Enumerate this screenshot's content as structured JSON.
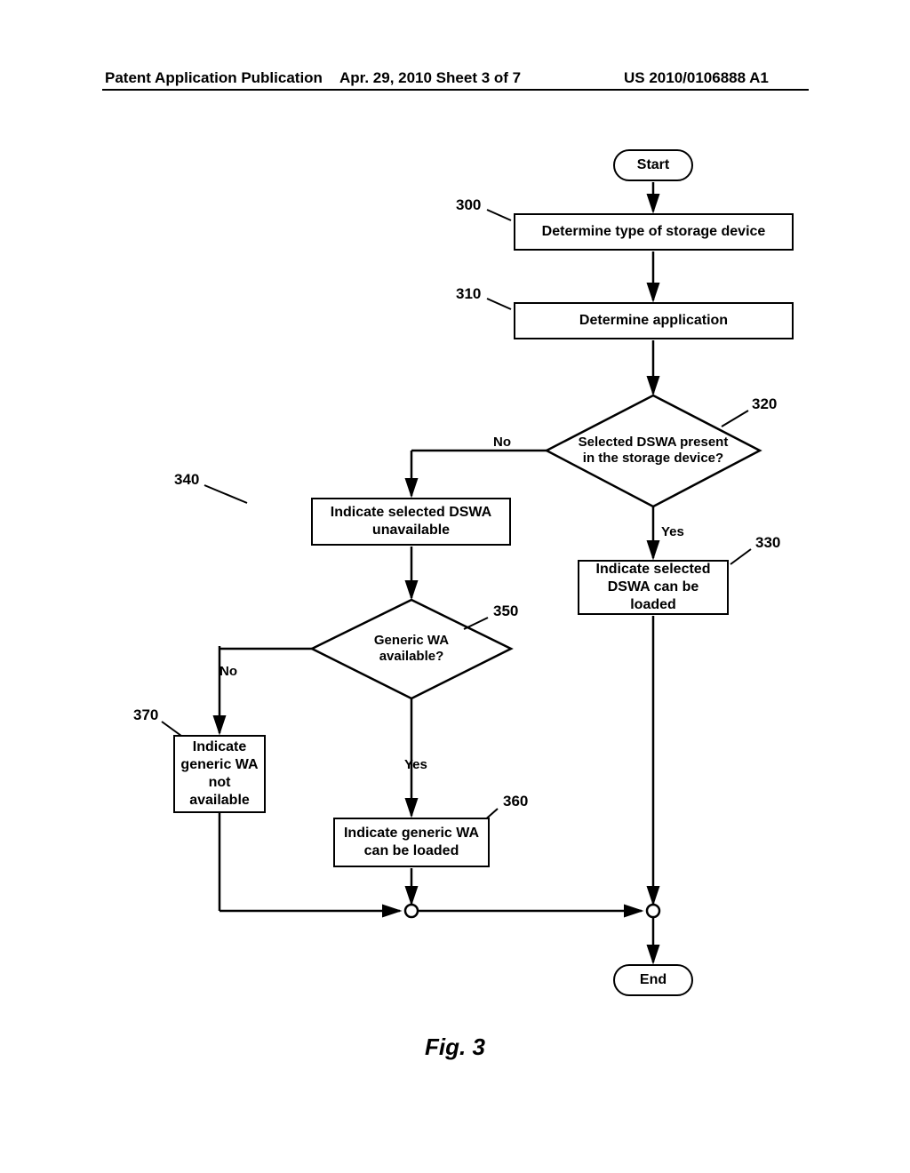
{
  "header": {
    "left": "Patent Application Publication",
    "center": "Apr. 29, 2010  Sheet 3 of 7",
    "right": "US 2010/0106888 A1"
  },
  "labels": {
    "n300": "300",
    "n310": "310",
    "n320": "320",
    "n330": "330",
    "n340": "340",
    "n350": "350",
    "n360": "360",
    "n370": "370"
  },
  "nodes": {
    "start": "Start",
    "b300": "Determine type of storage device",
    "b310": "Determine application",
    "d320": "Selected DSWA present in the storage device?",
    "b330": "Indicate selected DSWA can be loaded",
    "b340": "Indicate selected DSWA unavailable",
    "d350": "Generic WA available?",
    "b360": "Indicate generic WA can be loaded",
    "b370": "Indicate generic WA not available",
    "end": "End"
  },
  "edges": {
    "yes": "Yes",
    "no": "No"
  },
  "figcap": "Fig. 3",
  "chart_data": {
    "type": "flowchart",
    "nodes": [
      {
        "id": "start",
        "type": "terminal",
        "label": "Start"
      },
      {
        "id": "300",
        "type": "process",
        "label": "Determine type of storage device"
      },
      {
        "id": "310",
        "type": "process",
        "label": "Determine application"
      },
      {
        "id": "320",
        "type": "decision",
        "label": "Selected DSWA present in the storage device?"
      },
      {
        "id": "330",
        "type": "process",
        "label": "Indicate selected DSWA can be loaded"
      },
      {
        "id": "340",
        "type": "process",
        "label": "Indicate selected DSWA unavailable"
      },
      {
        "id": "350",
        "type": "decision",
        "label": "Generic WA available?"
      },
      {
        "id": "360",
        "type": "process",
        "label": "Indicate generic WA can be loaded"
      },
      {
        "id": "370",
        "type": "process",
        "label": "Indicate generic WA not available"
      },
      {
        "id": "join1",
        "type": "connector"
      },
      {
        "id": "join2",
        "type": "connector"
      },
      {
        "id": "end",
        "type": "terminal",
        "label": "End"
      }
    ],
    "edges": [
      {
        "from": "start",
        "to": "300"
      },
      {
        "from": "300",
        "to": "310"
      },
      {
        "from": "310",
        "to": "320"
      },
      {
        "from": "320",
        "to": "330",
        "label": "Yes"
      },
      {
        "from": "320",
        "to": "340",
        "label": "No"
      },
      {
        "from": "340",
        "to": "350"
      },
      {
        "from": "350",
        "to": "360",
        "label": "Yes"
      },
      {
        "from": "350",
        "to": "370",
        "label": "No"
      },
      {
        "from": "360",
        "to": "join1"
      },
      {
        "from": "370",
        "to": "join1"
      },
      {
        "from": "join1",
        "to": "join2"
      },
      {
        "from": "330",
        "to": "join2"
      },
      {
        "from": "join2",
        "to": "end"
      }
    ]
  }
}
